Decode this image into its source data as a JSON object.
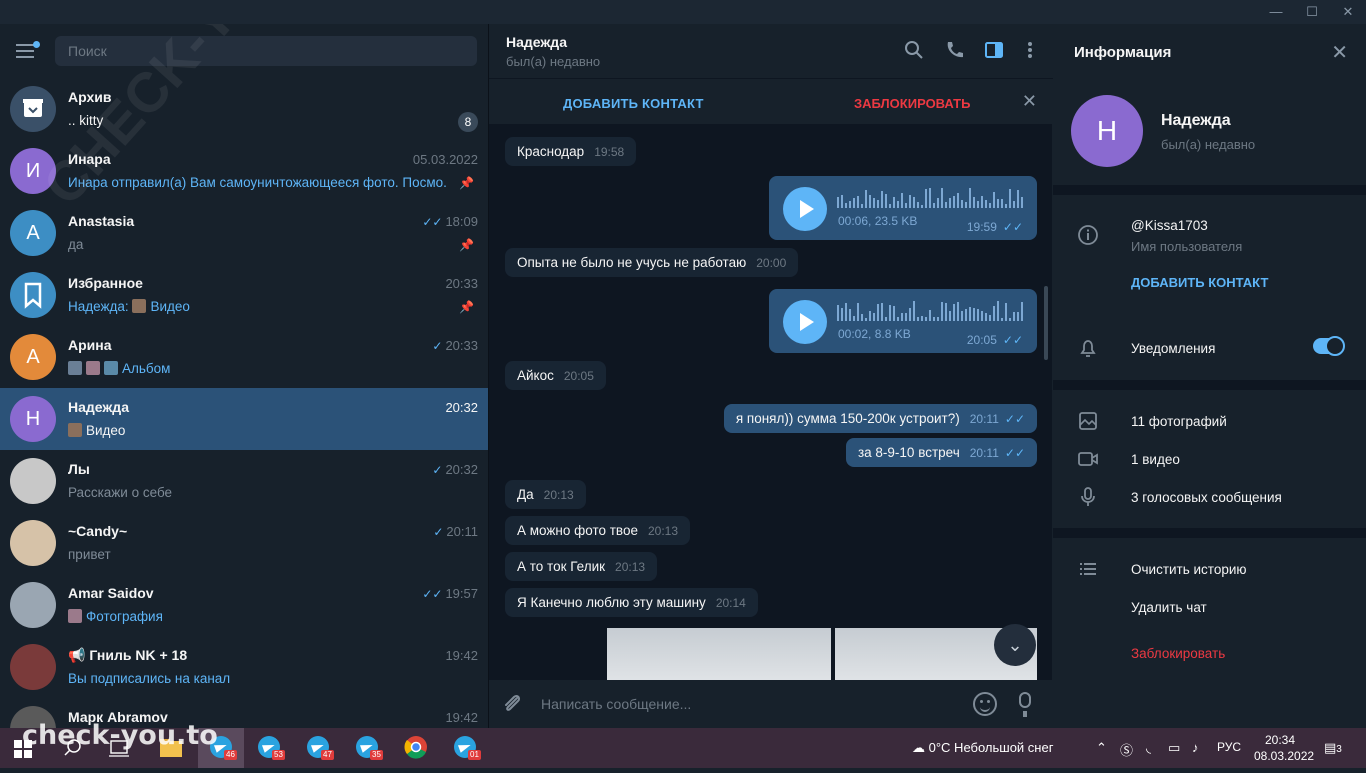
{
  "window": {
    "minimize": "—",
    "maximize": "☐",
    "close": "✕"
  },
  "left": {
    "search_placeholder": "Поиск",
    "chats": [
      {
        "name": "Архив",
        "preview": ".. kitty",
        "badge": "8",
        "avatar": "archive-icon",
        "color": "#3a5068"
      },
      {
        "name": "Инара",
        "time": "05.03.2022",
        "preview": "Инара отправил(а) Вам самоуничтожающееся фото. Посмо...",
        "initial": "И",
        "color": "#8a6ad0",
        "pinned": true
      },
      {
        "name": "Anastasia",
        "time": "18:09",
        "preview": "да",
        "initial": "A",
        "color": "#3d8ec4",
        "pinned": true,
        "ticks": "✓✓"
      },
      {
        "name": "Избранное",
        "time": "20:33",
        "preview_prefix": "Надежда:",
        "preview": "Видео",
        "color": "#3d8ec4",
        "pinned": true
      },
      {
        "name": "Арина",
        "time": "20:33",
        "preview": "Альбом",
        "initial": "А",
        "color": "#e38a3a",
        "ticks": "✓"
      },
      {
        "name": "Надежда",
        "time": "20:32",
        "preview": "Видео",
        "initial": "Н",
        "color": "#8a6ad0"
      },
      {
        "name": "Лы",
        "time": "20:32",
        "preview": "Расскажи о себе",
        "color": "#c8c8c8",
        "ticks": "✓"
      },
      {
        "name": "~Candy~",
        "time": "20:11",
        "preview": "привет",
        "color": "#d6c2a8",
        "ticks": "✓"
      },
      {
        "name": "Amar Saidov",
        "time": "19:57",
        "preview": "Фотография",
        "color": "#9aa6b2",
        "ticks": "✓✓"
      },
      {
        "name": "Гниль NK + 18",
        "time": "19:42",
        "preview": "Вы подписались на канал",
        "color": "#7a3a3a"
      },
      {
        "name": "Марк Abramov",
        "time": "19:42",
        "preview": "",
        "color": "#5a5a5a"
      }
    ]
  },
  "header": {
    "name": "Надежда",
    "status": "был(а) недавно"
  },
  "actionbar": {
    "add_contact": "ДОБАВИТЬ КОНТАКТ",
    "block": "ЗАБЛОКИРОВАТЬ"
  },
  "messages": [
    {
      "text": "Краснодар",
      "time": "19:58"
    },
    {
      "voice_meta": "00:06, 23.5 KB",
      "time": "19:59"
    },
    {
      "text": "Опыта не было не учусь не работаю",
      "time": "20:00"
    },
    {
      "voice_meta": "00:02, 8.8 KB",
      "time": "20:05"
    },
    {
      "text": "Айкос",
      "time": "20:05"
    },
    {
      "text": "я понял)) сумма 150-200к устроит?)",
      "time": "20:11"
    },
    {
      "text": "за 8-9-10 встреч",
      "time": "20:11"
    },
    {
      "text": "Да",
      "time": "20:13"
    },
    {
      "text": "А можно фото твое",
      "time": "20:13"
    },
    {
      "text": "А то ток Гелик",
      "time": "20:13"
    },
    {
      "text": "Я Канечно  люблю эту машину",
      "time": "20:14"
    }
  ],
  "composer": {
    "placeholder": "Написать сообщение..."
  },
  "info": {
    "title": "Информация",
    "initial": "Н",
    "name": "Надежда",
    "status": "был(а) недавно",
    "username": "@Kissa1703",
    "username_label": "Имя пользователя",
    "add_contact": "ДОБАВИТЬ КОНТАКТ",
    "notifications": "Уведомления",
    "notifications_on": true,
    "photos": "11 фотографий",
    "videos": "1 видео",
    "voice": "3 голосовых сообщения",
    "clear": "Очистить историю",
    "delete": "Удалить чат",
    "block": "Заблокировать"
  },
  "taskbar": {
    "badges": [
      "46",
      "53",
      "47",
      "35",
      "01"
    ],
    "weather": "0°C  Небольшой снег",
    "lang": "РУС",
    "time": "20:34",
    "date": "08.03.2022",
    "notif_count": "3"
  },
  "watermark": "check-you.to",
  "watermark_diag": "CHECK-YOU.ME"
}
